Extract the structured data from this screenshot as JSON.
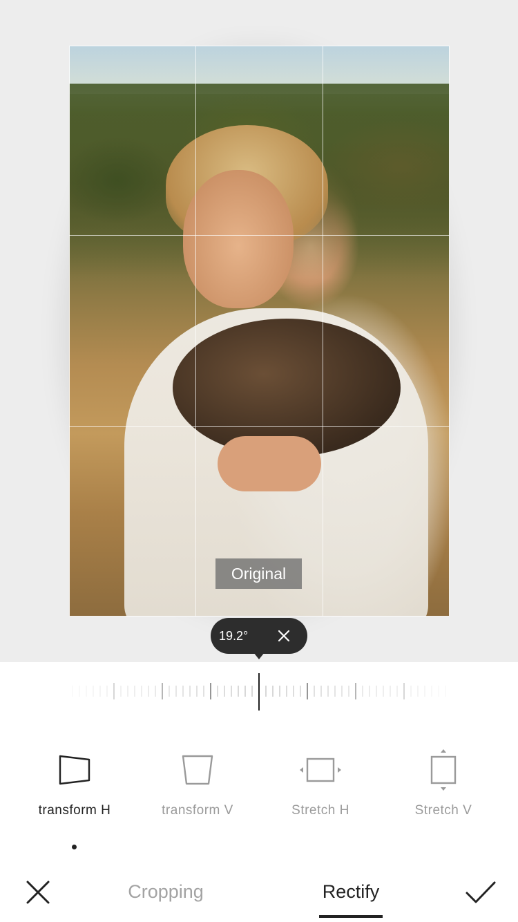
{
  "canvas": {
    "original_label": "Original"
  },
  "angle": {
    "value": "19.2°"
  },
  "tools": [
    {
      "label": "transform H",
      "icon": "transform-h-icon",
      "active": true
    },
    {
      "label": "transform V",
      "icon": "transform-v-icon",
      "active": false
    },
    {
      "label": "Stretch H",
      "icon": "stretch-h-icon",
      "active": false
    },
    {
      "label": "Stretch V",
      "icon": "stretch-v-icon",
      "active": false
    }
  ],
  "bottom_bar": {
    "close_icon": "close-icon",
    "confirm_icon": "checkmark-icon",
    "tab_cropping": "Cropping",
    "tab_rectify": "Rectify",
    "active_tab": "Rectify"
  },
  "colors": {
    "canvas_bg": "#ededed",
    "active_text": "#222222",
    "inactive_text": "#9a9a9a",
    "pill_bg": "#2d2d2d"
  }
}
